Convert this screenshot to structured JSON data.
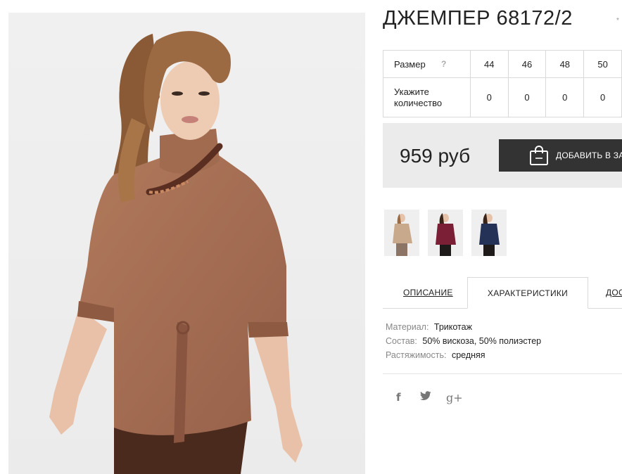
{
  "product": {
    "title": "ДЖЕМПЕР 68172/2",
    "fav_mark": "*"
  },
  "size_table": {
    "size_label": "Размер",
    "help": "?",
    "sizes": [
      "44",
      "46",
      "48",
      "50"
    ],
    "qty_label": "Укажите количество",
    "quantities": [
      "0",
      "0",
      "0",
      "0"
    ]
  },
  "price": {
    "value": "959 руб",
    "add_to_cart": "ДОБАВИТЬ В ЗА"
  },
  "thumbnails": [
    {
      "color": "#c9a98b",
      "alt": "beige"
    },
    {
      "color": "#7a1f35",
      "alt": "burgundy"
    },
    {
      "color": "#243258",
      "alt": "navy"
    }
  ],
  "tabs": [
    {
      "label": "ОПИСАНИЕ",
      "active": false
    },
    {
      "label": "ХАРАКТЕРИСТИКИ",
      "active": true
    },
    {
      "label": "ДОС",
      "active": false
    }
  ],
  "specs": [
    {
      "key": "Материал:",
      "value": "Трикотаж"
    },
    {
      "key": "Состав:",
      "value": "50% вискоза, 50% полиэстер"
    },
    {
      "key": "Растяжимость:",
      "value": "средняя"
    }
  ],
  "social": {
    "facebook": "f",
    "twitter": "🐦",
    "gplus": "g+"
  },
  "colors": {
    "sweater": "#a56b4e",
    "button": "#333333",
    "price_bg": "#ebebeb"
  }
}
